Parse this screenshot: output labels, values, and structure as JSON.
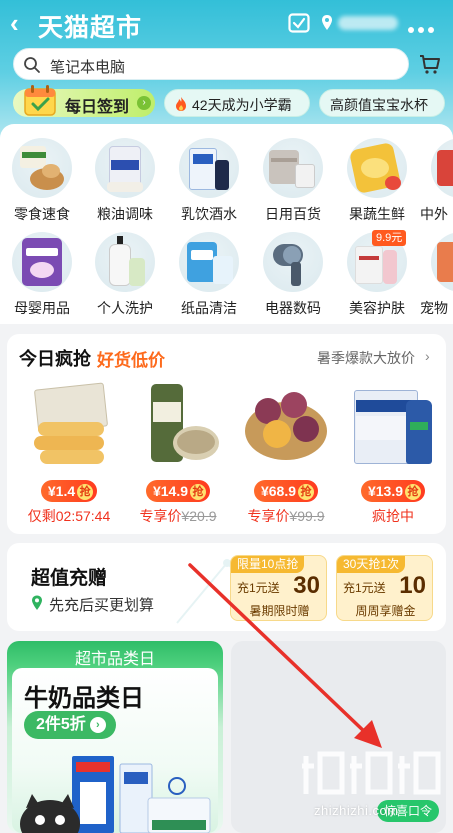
{
  "header": {
    "title": "天猫超市",
    "search_placeholder": "笔记本电脑",
    "colors": {
      "accent": "#33bfd8",
      "white": "#ffffff"
    }
  },
  "tags": {
    "signin": "每日签到",
    "challenge": "42天成为小学霸",
    "promo": "高颜值宝宝水杯"
  },
  "categories": [
    {
      "label": "零食速食",
      "icon": "snacks-icon"
    },
    {
      "label": "粮油调味",
      "icon": "grain-oil-icon"
    },
    {
      "label": "乳饮酒水",
      "icon": "milk-drinks-icon"
    },
    {
      "label": "日用百货",
      "icon": "household-icon"
    },
    {
      "label": "果蔬生鲜",
      "icon": "fresh-produce-icon"
    },
    {
      "label": "中外",
      "icon": "imported-icon"
    },
    {
      "label": "母婴用品",
      "icon": "baby-products-icon"
    },
    {
      "label": "个人洗护",
      "icon": "personal-care-icon"
    },
    {
      "label": "纸品清洁",
      "icon": "paper-cleaning-icon"
    },
    {
      "label": "电器数码",
      "icon": "appliances-icon"
    },
    {
      "label": "美容护肤",
      "icon": "skincare-icon",
      "badge": "9.9元"
    },
    {
      "label": "宠物",
      "icon": "pet-icon"
    }
  ],
  "flash_sale": {
    "title": "今日疯抢",
    "subtitle": "好货低价",
    "more": "暑季爆款大放价",
    "qiang": "抢",
    "products": [
      {
        "name": "wafer-rolls",
        "price": "¥1.4",
        "note": "仅剩02:57:44",
        "old_price": ""
      },
      {
        "name": "seasoning-jar",
        "price": "¥14.9",
        "note": "专享价",
        "old_price": "¥20.9"
      },
      {
        "name": "plums",
        "price": "¥68.9",
        "note": "专享价",
        "old_price": "¥99.9"
      },
      {
        "name": "tsingtao-beer",
        "price": "¥13.9",
        "note": "疯抢中",
        "old_price": ""
      }
    ]
  },
  "recharge": {
    "title": "超值充赠",
    "subtitle": "先充后买更划算",
    "coupons": [
      {
        "badge": "限量10点抢",
        "line1": "充1元送",
        "amount": "30",
        "line2": "暑期限时赠"
      },
      {
        "badge": "30天抢1次",
        "line1": "充1元送",
        "amount": "10",
        "line2": "周周享赠金"
      }
    ]
  },
  "category_day": {
    "header": "超市品类日",
    "title": "牛奶品类日",
    "deal": "2件5折"
  },
  "right_card": {
    "surprise": "惊喜口令"
  },
  "watermark": {
    "logo": "值值值",
    "text": "zhizhizhi.com"
  }
}
